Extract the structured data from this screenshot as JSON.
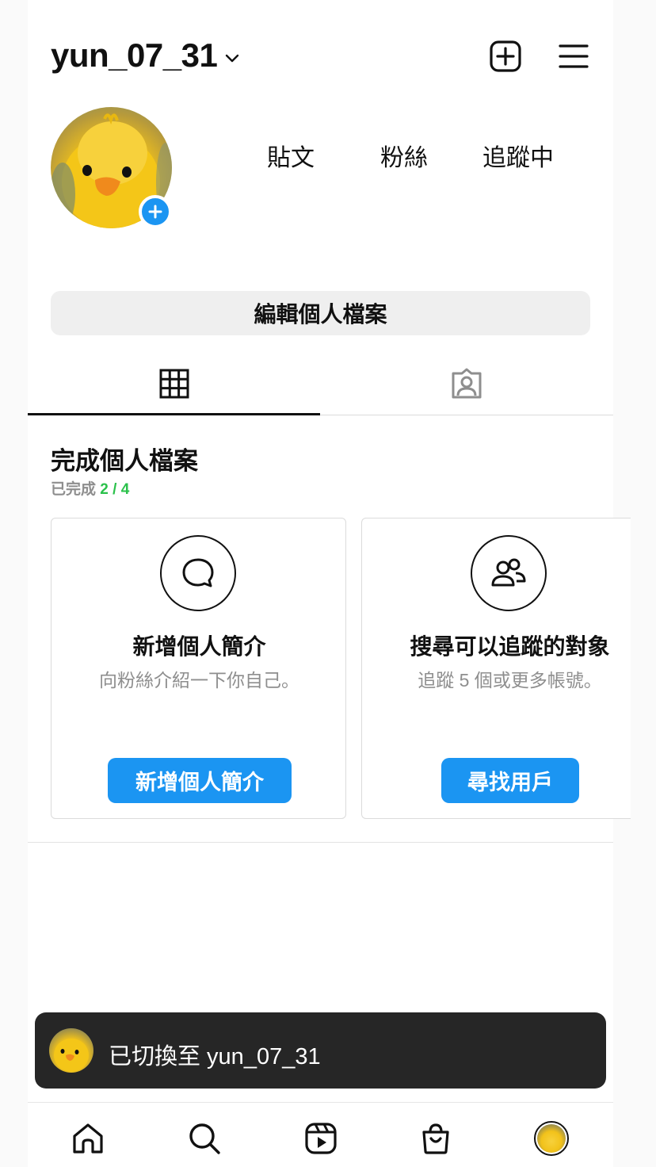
{
  "header": {
    "username": "yun_07_31",
    "icons": {
      "switch": "chevron-down-icon",
      "new_post": "plus-square-icon",
      "menu": "hamburger-menu-icon"
    }
  },
  "profile": {
    "stats": {
      "posts_label": "貼文",
      "followers_label": "粉絲",
      "following_label": "追蹤中"
    },
    "edit_label": "編輯個人檔案"
  },
  "tabs": [
    {
      "icon": "grid-icon",
      "active": true
    },
    {
      "icon": "tagged-user-icon",
      "active": false
    }
  ],
  "complete_profile": {
    "title": "完成個人檔案",
    "progress_prefix": "已完成",
    "progress_value": "2 / 4",
    "cards": [
      {
        "icon": "speech-bubble-icon",
        "title": "新增個人簡介",
        "subtitle": "向粉絲介紹一下你自己。",
        "button": "新增個人簡介"
      },
      {
        "icon": "people-icon",
        "title": "搜尋可以追蹤的對象",
        "subtitle": "追蹤 5 個或更多帳號。",
        "button": "尋找用戶"
      }
    ]
  },
  "toast": {
    "text": "已切換至 yun_07_31"
  },
  "bottom_nav": [
    {
      "icon": "home-icon"
    },
    {
      "icon": "search-icon"
    },
    {
      "icon": "reels-icon"
    },
    {
      "icon": "shop-icon"
    },
    {
      "icon": "profile-avatar-icon"
    }
  ],
  "colors": {
    "accent": "#1b95f2",
    "progress_green": "#2bc14b",
    "toast_bg": "#262626"
  }
}
